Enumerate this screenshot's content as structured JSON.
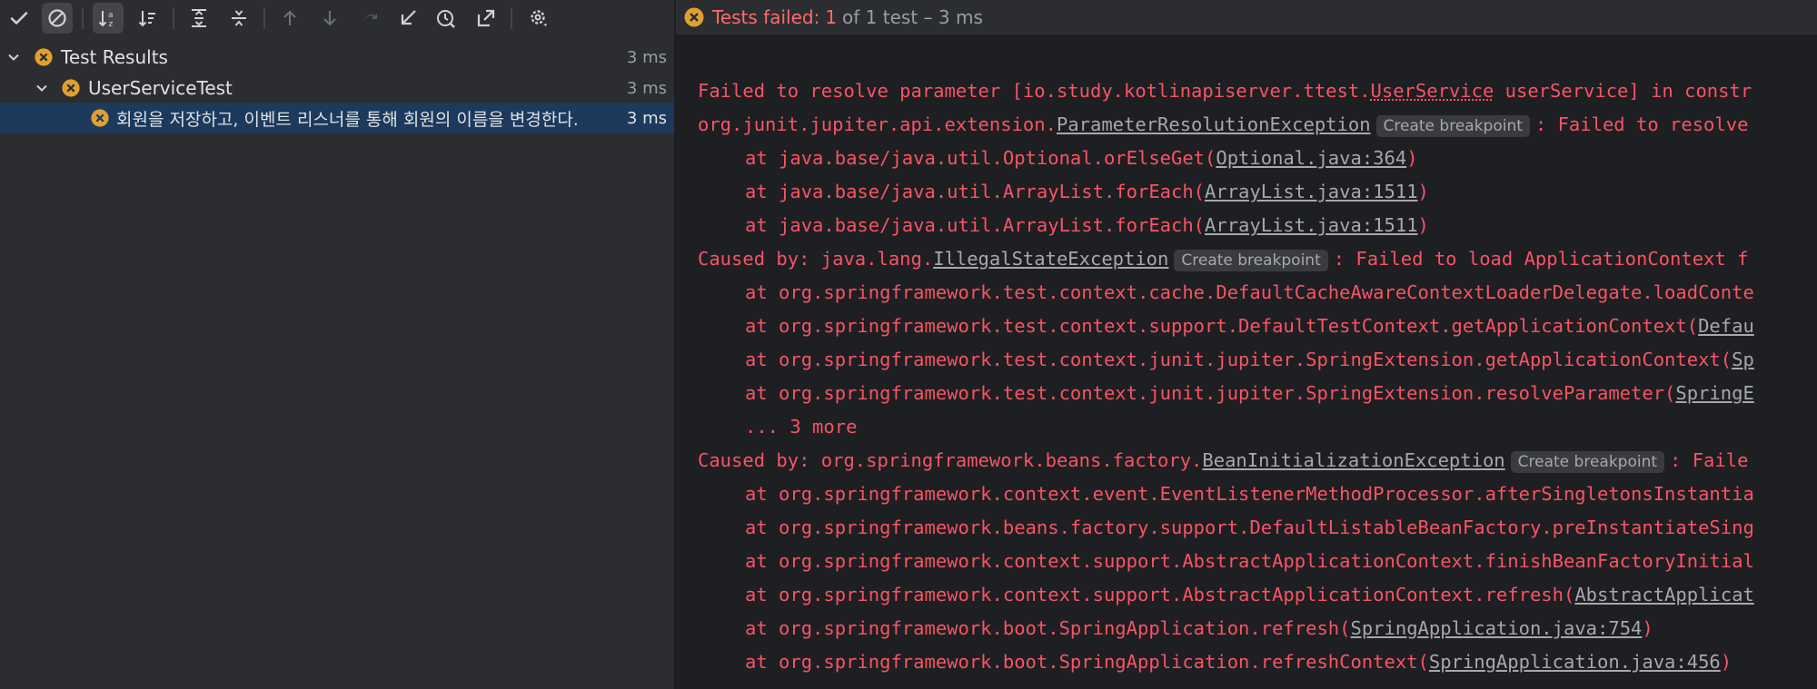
{
  "toolbar": {
    "buttons": [
      {
        "name": "show-passed-icon",
        "active": false
      },
      {
        "name": "show-ignored-icon",
        "active": true
      },
      {
        "name": "sort-alphabetically-icon",
        "active": true
      },
      {
        "name": "sort-by-duration-icon",
        "active": false
      },
      {
        "name": "expand-all-icon",
        "active": false
      },
      {
        "name": "collapse-all-icon",
        "active": false
      },
      {
        "name": "previous-failed-icon",
        "active": false
      },
      {
        "name": "next-failed-icon",
        "active": false
      },
      {
        "name": "rerun-icon",
        "active": false
      },
      {
        "name": "import-tests-icon",
        "active": false
      },
      {
        "name": "test-history-icon",
        "active": false
      },
      {
        "name": "export-results-icon",
        "active": false
      },
      {
        "name": "settings-icon",
        "active": false
      }
    ]
  },
  "status": {
    "failed_label": "Tests failed:",
    "failed_count": "1",
    "rest": "of 1 test – 3 ms"
  },
  "tree": {
    "root": {
      "label": "Test Results",
      "time": "3 ms"
    },
    "suite": {
      "label": "UserServiceTest",
      "time": "3 ms"
    },
    "test": {
      "label": "회원을 저장하고, 이벤트 리스너를 통해 회원의 이름을 변경한다.",
      "time": "3 ms"
    }
  },
  "console": {
    "create_breakpoint": "Create breakpoint",
    "l1": {
      "a": "Failed to resolve parameter [io.study.kotlinapiserver.ttest.",
      "link": "UserService",
      "b": " userService] in constr"
    },
    "l2": {
      "a": "org.junit.jupiter.api.extension.",
      "link": "ParameterResolutionException",
      "b": ": Failed to resolve"
    },
    "l3": {
      "a": "at java.base/java.util.Optional.orElseGet(",
      "link": "Optional.java:364",
      "b": ")"
    },
    "l4": {
      "a": "at java.base/java.util.ArrayList.forEach(",
      "link": "ArrayList.java:1511",
      "b": ")"
    },
    "l5": {
      "a": "at java.base/java.util.ArrayList.forEach(",
      "link": "ArrayList.java:1511",
      "b": ")"
    },
    "l6": {
      "a": "Caused by: java.lang.",
      "link": "IllegalStateException",
      "b": ": Failed to load ApplicationContext f"
    },
    "l7": {
      "a": "at org.springframework.test.context.cache.DefaultCacheAwareContextLoaderDelegate.loadConte"
    },
    "l8": {
      "a": "at org.springframework.test.context.support.DefaultTestContext.getApplicationContext(",
      "link": "Defau"
    },
    "l9": {
      "a": "at org.springframework.test.context.junit.jupiter.SpringExtension.getApplicationContext(",
      "link": "Sp"
    },
    "l10": {
      "a": "at org.springframework.test.context.junit.jupiter.SpringExtension.resolveParameter(",
      "link": "SpringE"
    },
    "l11": {
      "a": "... 3 more"
    },
    "l12": {
      "a": "Caused by: org.springframework.beans.factory.",
      "link": "BeanInitializationException",
      "b": ": Faile"
    },
    "l13": {
      "a": "at org.springframework.context.event.EventListenerMethodProcessor.afterSingletonsInstantia"
    },
    "l14": {
      "a": "at org.springframework.beans.factory.support.DefaultListableBeanFactory.preInstantiateSing"
    },
    "l15": {
      "a": "at org.springframework.context.support.AbstractApplicationContext.finishBeanFactoryInitial"
    },
    "l16": {
      "a": "at org.springframework.context.support.AbstractApplicationContext.refresh(",
      "link": "AbstractApplicat"
    },
    "l17": {
      "a": "at org.springframework.boot.SpringApplication.refresh(",
      "link": "SpringApplication.java:754",
      "b": ")"
    },
    "l18": {
      "a": "at org.springframework.boot.SpringApplication.refreshContext(",
      "link": "SpringApplication.java:456",
      "b": ")"
    }
  },
  "colors": {
    "error": "#f75464",
    "fail_icon": "#e0a030",
    "selection": "#1d3a5c",
    "panel": "#2b2d30",
    "console_bg": "#1e1f22"
  }
}
